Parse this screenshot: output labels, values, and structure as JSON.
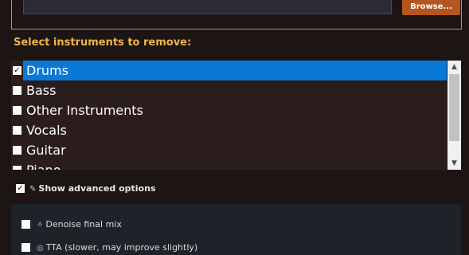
{
  "file_section": {
    "input_value": "",
    "browse_label": "Browse..."
  },
  "instruments": {
    "heading": "Select instruments to remove:",
    "items": [
      {
        "label": "Drums",
        "checked": true,
        "selected": true
      },
      {
        "label": "Bass",
        "checked": false,
        "selected": false
      },
      {
        "label": "Other Instruments",
        "checked": false,
        "selected": false
      },
      {
        "label": "Vocals",
        "checked": false,
        "selected": false
      },
      {
        "label": "Guitar",
        "checked": false,
        "selected": false
      },
      {
        "label": "Piano",
        "checked": false,
        "selected": false
      }
    ]
  },
  "advanced": {
    "toggle_label": "Show advanced options",
    "toggle_checked": true,
    "options": [
      {
        "label": "Denoise final mix",
        "icon": "magic-wand-icon",
        "checked": false
      },
      {
        "label": "TTA (slower, may improve slightly)",
        "icon": "target-icon",
        "checked": false
      }
    ]
  },
  "colors": {
    "accent": "#b55520",
    "heading": "#f0b54a",
    "selection": "#0a78d7"
  }
}
